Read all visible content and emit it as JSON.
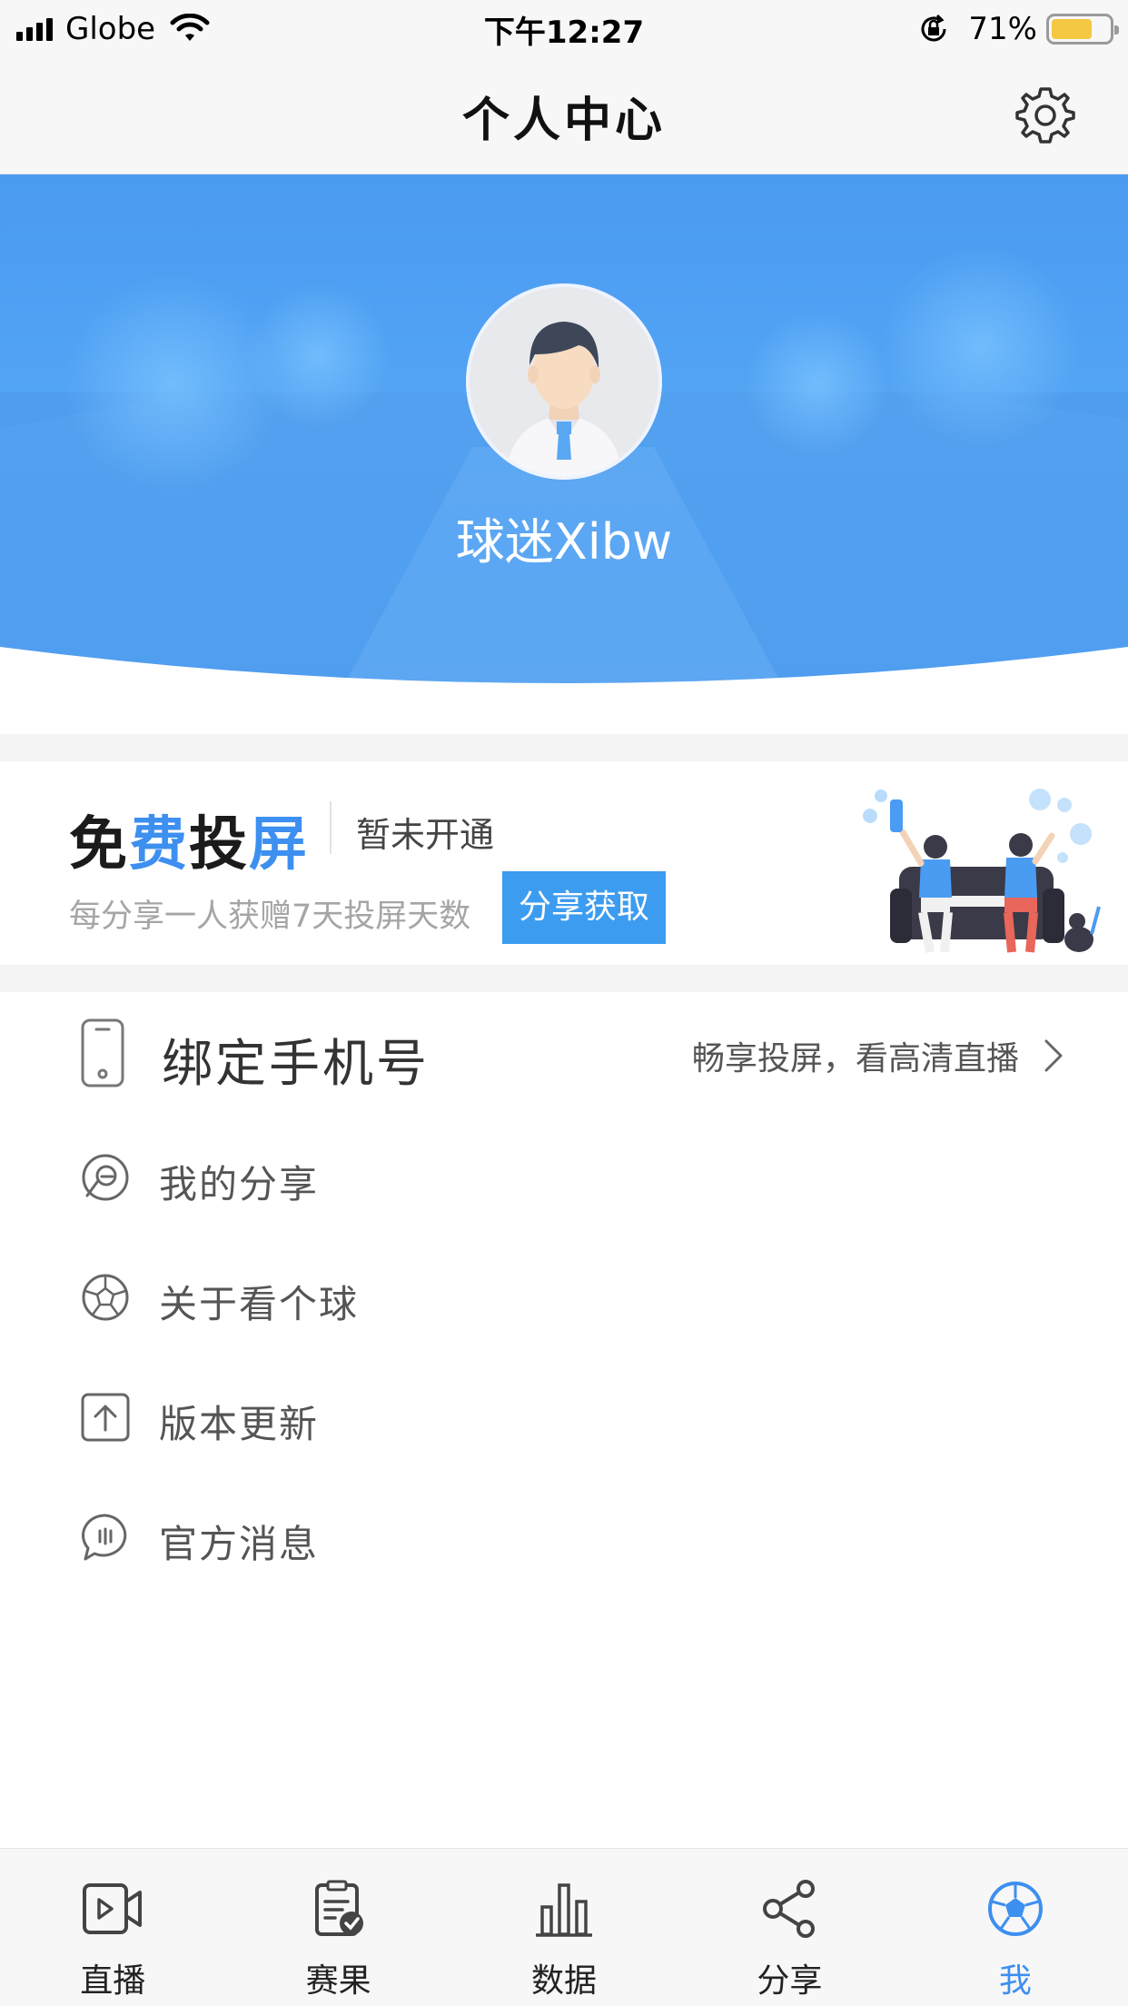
{
  "status_bar": {
    "carrier": "Globe",
    "time": "下午12:27",
    "battery_percent": "71%",
    "battery_level": 0.71,
    "battery_color": "#f4c842"
  },
  "nav": {
    "title": "个人中心",
    "settings_icon": "gear-icon"
  },
  "profile": {
    "username": "球迷Xibw",
    "avatar_icon": "user-avatar-icon",
    "hero_color": "#4a9bf2"
  },
  "promo": {
    "title_parts": [
      "免",
      "费",
      "投",
      "屏"
    ],
    "status": "暂未开通",
    "description": "每分享一人获赠7天投屏天数",
    "button_label": "分享获取",
    "accent_color": "#3d8ff0"
  },
  "bind_phone": {
    "label": "绑定手机号",
    "hint": "畅享投屏，看高清直播",
    "icon": "phone-icon"
  },
  "menu": {
    "items": [
      {
        "label": "我的分享",
        "icon": "share-history-icon"
      },
      {
        "label": "关于看个球",
        "icon": "soccer-ball-icon"
      },
      {
        "label": "版本更新",
        "icon": "upload-icon"
      },
      {
        "label": "官方消息",
        "icon": "message-icon"
      }
    ]
  },
  "tabs": {
    "items": [
      {
        "label": "直播",
        "icon": "live-video-icon",
        "active": false
      },
      {
        "label": "赛果",
        "icon": "results-clipboard-icon",
        "active": false
      },
      {
        "label": "数据",
        "icon": "bar-chart-icon",
        "active": false
      },
      {
        "label": "分享",
        "icon": "share-icon",
        "active": false
      },
      {
        "label": "我",
        "icon": "soccer-ball-icon",
        "active": true
      }
    ],
    "active_color": "#3d8ff0"
  }
}
